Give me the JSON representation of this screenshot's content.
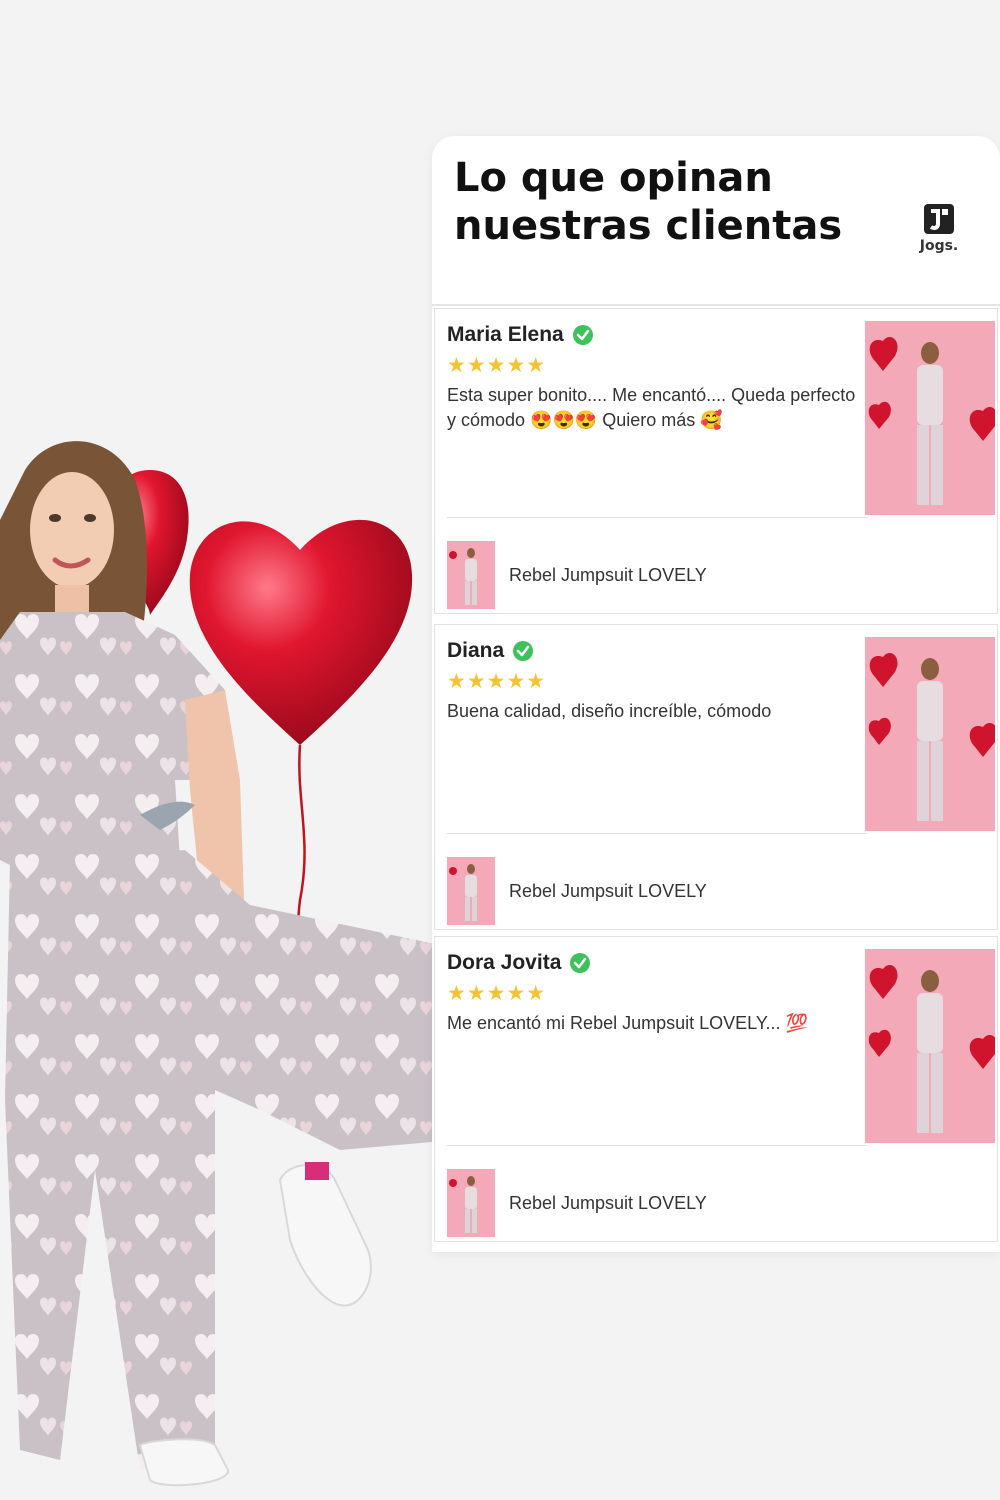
{
  "panel": {
    "title": "Lo que opinan nuestras clientas",
    "brand": {
      "name": "Jogs.",
      "icon": "jogs-logo-icon"
    }
  },
  "reviews": [
    {
      "name": "Maria Elena",
      "verified_icon": "verified-check-icon",
      "rating": 5,
      "stars": "★★★★★",
      "text": "Esta super bonito.... Me encantó.... Queda perfecto y cómodo 😍😍😍 Quiero más 🥰",
      "product": "Rebel Jumpsuit LOVELY"
    },
    {
      "name": "Diana",
      "verified_icon": "verified-check-icon",
      "rating": 5,
      "stars": "★★★★★",
      "text": "Buena calidad, diseño increíble, cómodo",
      "product": "Rebel Jumpsuit LOVELY"
    },
    {
      "name": "Dora Jovita",
      "verified_icon": "verified-check-icon",
      "rating": 5,
      "stars": "★★★★★",
      "text": "Me encantó mi Rebel Jumpsuit LOVELY... 💯",
      "product": "Rebel Jumpsuit LOVELY"
    }
  ],
  "colors": {
    "star": "#f3c432",
    "verified": "#3cc15b",
    "balloon": "#d2102a",
    "thumb_bg": "#f2a6b6"
  }
}
